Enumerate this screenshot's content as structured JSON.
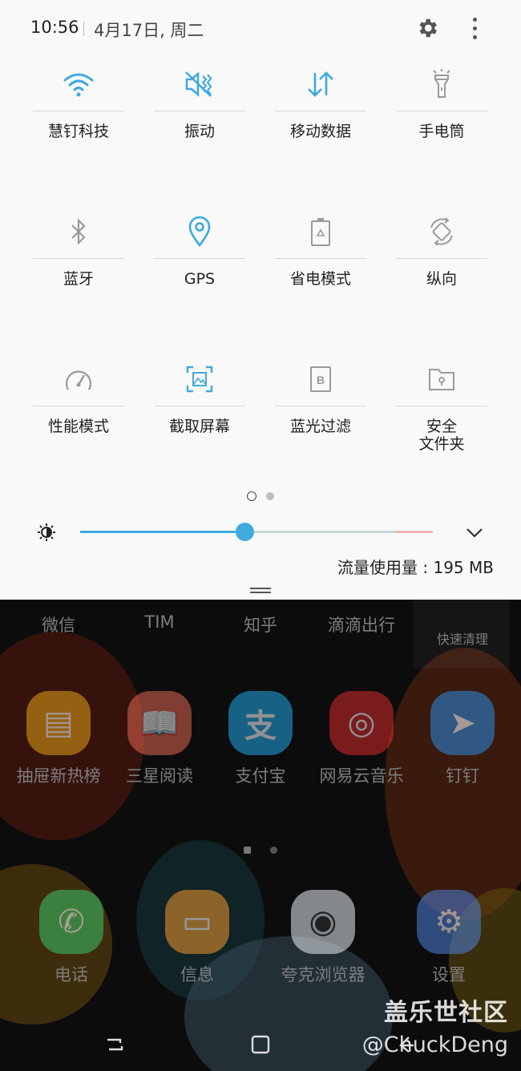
{
  "status": {
    "time": "10:56",
    "date": "4月17日, 周二"
  },
  "colors": {
    "accent": "#3fa9e0",
    "inactive_icon": "#9a9a9a"
  },
  "tiles": [
    {
      "label": "慧钉科技",
      "icon": "wifi-icon",
      "active": true
    },
    {
      "label": "振动",
      "icon": "vibrate-icon",
      "active": true
    },
    {
      "label": "移动数据",
      "icon": "mobile-data-icon",
      "active": true
    },
    {
      "label": "手电筒",
      "icon": "flashlight-icon",
      "active": false
    },
    {
      "label": "蓝牙",
      "icon": "bluetooth-icon",
      "active": false
    },
    {
      "label": "GPS",
      "icon": "location-icon",
      "active": true
    },
    {
      "label": "省电模式",
      "icon": "power-saving-icon",
      "active": false
    },
    {
      "label": "纵向",
      "icon": "rotation-icon",
      "active": false
    },
    {
      "label": "性能模式",
      "icon": "performance-icon",
      "active": false
    },
    {
      "label": "截取屏幕",
      "icon": "screenshot-icon",
      "active": true
    },
    {
      "label": "蓝光过滤",
      "icon": "blue-light-filter-icon",
      "active": false
    },
    {
      "label": "安全\n文件夹",
      "icon": "secure-folder-icon",
      "active": false
    }
  ],
  "brightness": {
    "level": 0.465
  },
  "data_usage": "流量使用量 : 195 MB",
  "home": {
    "top_row": [
      "微信",
      "TIM",
      "知乎",
      "滴滴出行",
      "快速清理"
    ],
    "apps": [
      {
        "label": "抽屉新热榜",
        "color": "#e3a21a",
        "glyph": "▤"
      },
      {
        "label": "三星阅读",
        "color": "#e0664f",
        "glyph": "📖"
      },
      {
        "label": "支付宝",
        "color": "#21a9e6",
        "glyph": "支"
      },
      {
        "label": "网易云音乐",
        "color": "#d62a2a",
        "glyph": "◎"
      },
      {
        "label": "钉钉",
        "color": "#2c8be5",
        "glyph": "➤"
      }
    ],
    "dock": [
      {
        "label": "电话",
        "color": "#3cc46c",
        "glyph": "✆"
      },
      {
        "label": "信息",
        "color": "#f29a2e",
        "glyph": "▭"
      },
      {
        "label": "夸克浏览器",
        "color": "#e9eef2",
        "glyph": "◉"
      },
      {
        "label": "设置",
        "color": "#4f7fd9",
        "glyph": "⚙"
      }
    ]
  },
  "watermark": {
    "line1": "盖乐世社区",
    "line2": "@ChuckDeng"
  }
}
